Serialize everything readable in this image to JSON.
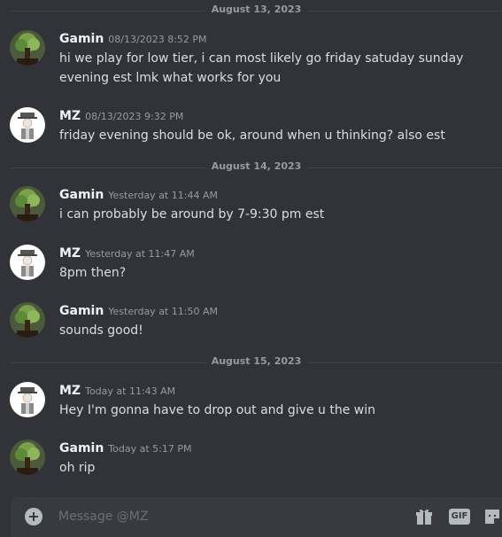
{
  "dividers": [
    {
      "label": "August 13, 2023"
    },
    {
      "label": "August 14, 2023"
    },
    {
      "label": "August 15, 2023"
    }
  ],
  "messages": [
    {
      "author": "Gamin",
      "timestamp": "08/13/2023 8:52 PM",
      "text": "hi we play for low tier, i can most likely go friday satuday sunday evening est lmk what works for you",
      "avatar": "tree-avatar"
    },
    {
      "author": "MZ",
      "timestamp": "08/13/2023 9:32 PM",
      "text": "friday evening should be ok, around when u thinking? also est",
      "avatar": "hat-avatar"
    },
    {
      "author": "Gamin",
      "timestamp": "Yesterday at 11:44 AM",
      "text": "i can probably be around by 7-9:30 pm est",
      "avatar": "tree-avatar"
    },
    {
      "author": "MZ",
      "timestamp": "Yesterday at 11:47 AM",
      "text": "8pm then?",
      "avatar": "hat-avatar"
    },
    {
      "author": "Gamin",
      "timestamp": "Yesterday at 11:50 AM",
      "text": "sounds good!",
      "avatar": "tree-avatar"
    },
    {
      "author": "MZ",
      "timestamp": "Today at 11:43 AM",
      "text": "Hey I'm gonna have to drop out and give u the win",
      "avatar": "hat-avatar"
    },
    {
      "author": "Gamin",
      "timestamp": "Today at 5:17 PM",
      "text": "oh rip",
      "avatar": "tree-avatar"
    }
  ],
  "composer": {
    "placeholder": "Message @MZ",
    "add_icon": "plus-circle-icon",
    "gift_icon": "gift-icon",
    "gif_label": "GIF",
    "sticker_icon": "sticker-icon"
  },
  "colors": {
    "background": "#313338",
    "composer_bg": "#383a40",
    "username": "#f2f3f5",
    "timestamp": "#949ba4",
    "text": "#dbdee1"
  }
}
